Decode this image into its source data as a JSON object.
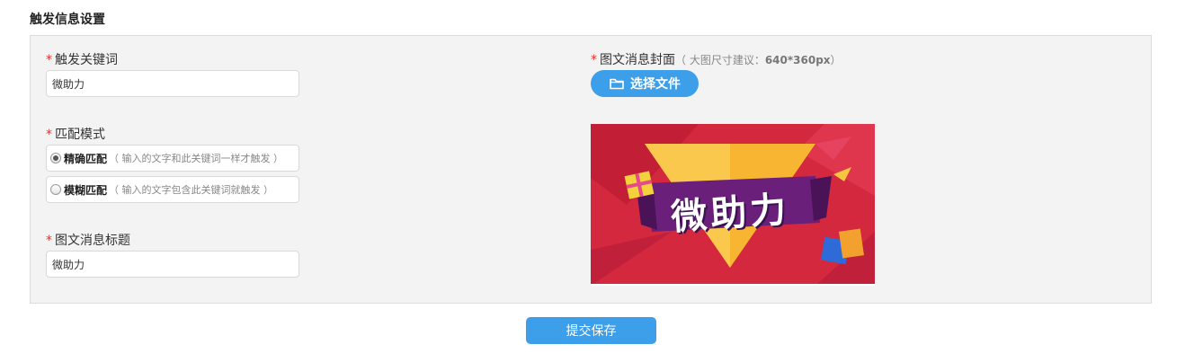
{
  "section_title": "触发信息设置",
  "form": {
    "keyword": {
      "required": "*",
      "label": "触发关键词",
      "value": "微助力"
    },
    "match_mode": {
      "required": "*",
      "label": "匹配模式",
      "options": [
        {
          "label": "精确匹配",
          "hint": "（ 输入的文字和此关键词一样才触发 ）",
          "checked": true
        },
        {
          "label": "模糊匹配",
          "hint": "（ 输入的文字包含此关键词就触发 ）",
          "checked": false
        }
      ]
    },
    "title": {
      "required": "*",
      "label": "图文消息标题",
      "value": "微助力"
    },
    "cover": {
      "required": "*",
      "label": "图文消息封面",
      "hint_prefix": "（ 大图尺寸建议：",
      "hint_size": "640*360px",
      "hint_suffix": "）",
      "button_label": "选择文件",
      "button_icon": "folder-icon",
      "preview_text": "微助力"
    }
  },
  "submit_label": "提交保存",
  "colors": {
    "accent": "#3d9ee9",
    "required": "#e0322f",
    "panel_bg": "#f3f3f3",
    "banner_bg": "#d4283f",
    "banner_triangle": "#f7b531",
    "banner_ribbon": "#6a1f7a"
  }
}
